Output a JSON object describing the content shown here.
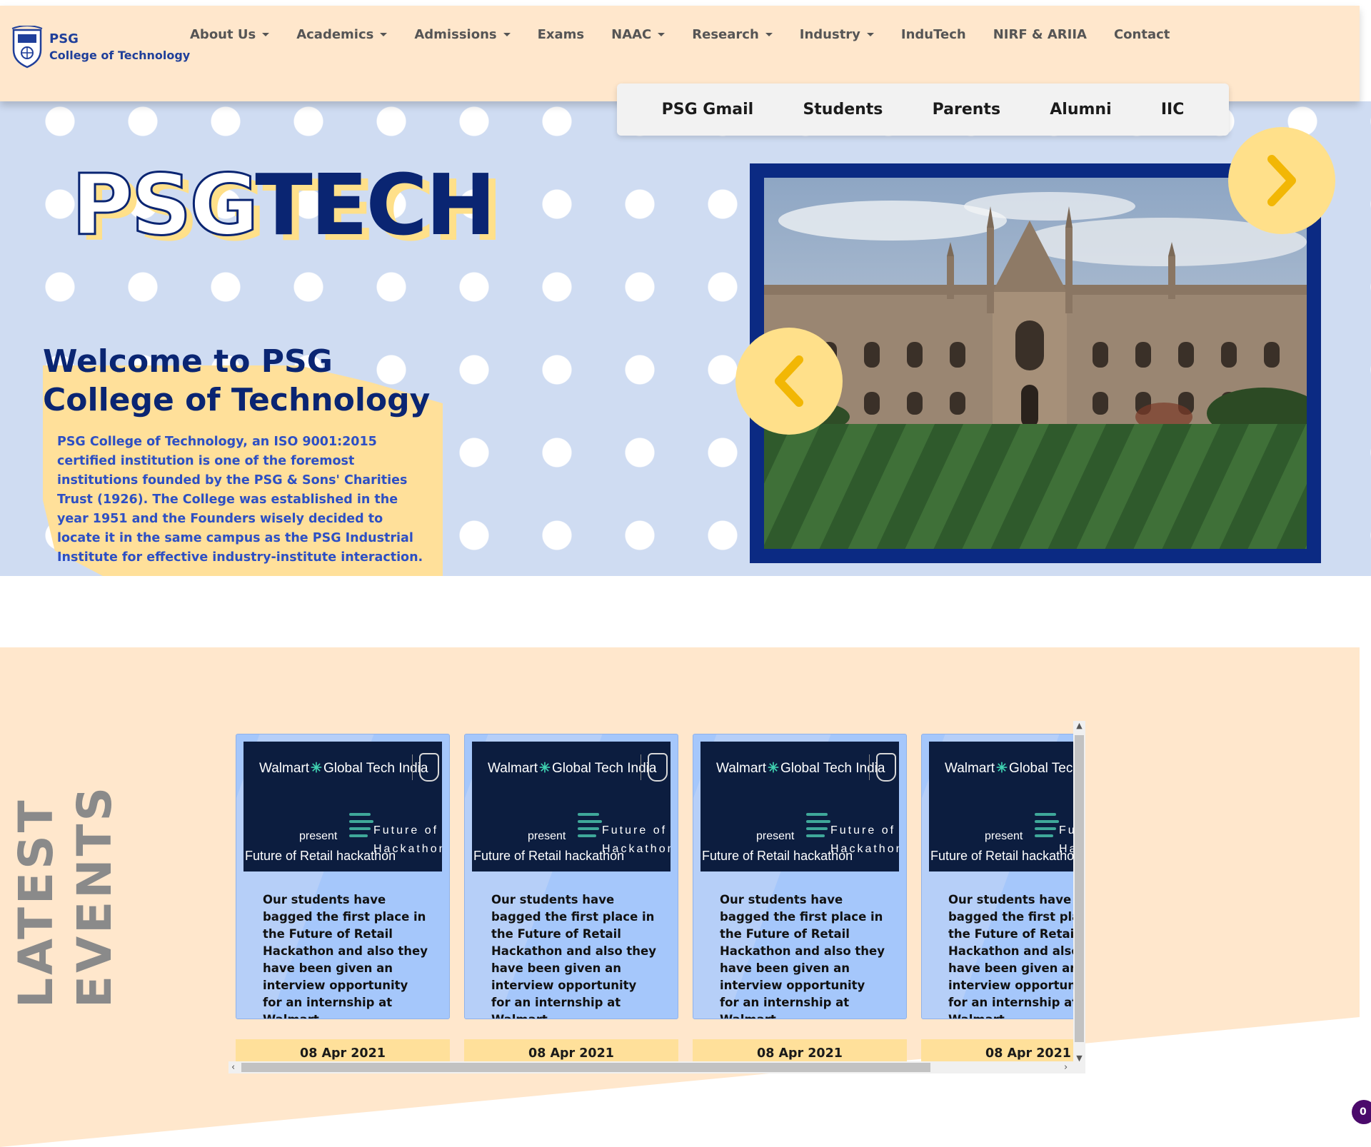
{
  "brand": {
    "line1": "PSG",
    "line2": "College of Technology",
    "crest_icon": "psg-crest-icon"
  },
  "nav": {
    "items": [
      {
        "label": "About Us",
        "dropdown": true
      },
      {
        "label": "Academics",
        "dropdown": true
      },
      {
        "label": "Admissions",
        "dropdown": true
      },
      {
        "label": "Exams",
        "dropdown": false
      },
      {
        "label": "NAAC",
        "dropdown": true
      },
      {
        "label": "Research",
        "dropdown": true
      },
      {
        "label": "Industry",
        "dropdown": true
      },
      {
        "label": "InduTech",
        "dropdown": false
      },
      {
        "label": "NIRF & ARIIA",
        "dropdown": false
      },
      {
        "label": "Contact",
        "dropdown": false
      }
    ]
  },
  "quicklinks": [
    "PSG Gmail",
    "Students",
    "Parents",
    "Alumni",
    "IIC"
  ],
  "hero": {
    "logo_outline": "PSG",
    "logo_solid": "TECH",
    "welcome_title": "Welcome to PSG College of Technology",
    "welcome_desc": "PSG College of Technology, an ISO 9001:2015 certified institution is one of the foremost institutions founded by the PSG & Sons' Charities Trust (1926). The College was established in the year 1951 and the Founders wisely decided to locate it in the same campus as the PSG Industrial Institute for effective industry-institute interaction.",
    "slider_prev_icon": "chevron-left-icon",
    "slider_next_icon": "chevron-right-icon"
  },
  "events": {
    "title_line1": "LATEST",
    "title_line2": "EVENTS",
    "items": [
      {
        "image_brand": "Walmart",
        "image_brand_suffix": "Global Tech India",
        "image_present": "present",
        "image_subtitle": "Future of Retail hackathon",
        "image_future_1": "Future of Retail",
        "image_future_2": "Hackathon",
        "text": "Our students have bagged the first place in the Future of Retail Hackathon and also they have been given an interview opportunity for an internship at Walmart.",
        "date": "08 Apr 2021"
      },
      {
        "image_brand": "Walmart",
        "image_brand_suffix": "Global Tech India",
        "image_present": "present",
        "image_subtitle": "Future of Retail hackathon",
        "image_future_1": "Future of Retail",
        "image_future_2": "Hackathon",
        "text": "Our students have bagged the first place in the Future of Retail Hackathon and also they have been given an interview opportunity for an internship at Walmart.",
        "date": "08 Apr 2021"
      },
      {
        "image_brand": "Walmart",
        "image_brand_suffix": "Global Tech India",
        "image_present": "present",
        "image_subtitle": "Future of Retail hackathon",
        "image_future_1": "Future of Retail",
        "image_future_2": "Hackathon",
        "text": "Our students have bagged the first place in the Future of Retail Hackathon and also they have been given an interview opportunity for an internship at Walmart.",
        "date": "08 Apr 2021"
      },
      {
        "image_brand": "Walmart",
        "image_brand_suffix": "Global Tech India",
        "image_present": "present",
        "image_subtitle": "Future of Retail hackathon",
        "image_future_1": "Future of Retail",
        "image_future_2": "Hackathon",
        "text": "Our students have bagged the first place in the Future of Retail Hackathon and also they have been given an interview opportunity for an internship at Walmart.",
        "date": "08 Apr 2021"
      }
    ]
  },
  "badge": {
    "count": "0"
  },
  "colors": {
    "header_bg": "#ffe7cc",
    "navy": "#0a2572",
    "accent_yellow": "#ffe08a",
    "hero_bg": "#cfdcf2",
    "card_blue": "#a5c7fb",
    "desc_blue": "#2d4fc4"
  }
}
